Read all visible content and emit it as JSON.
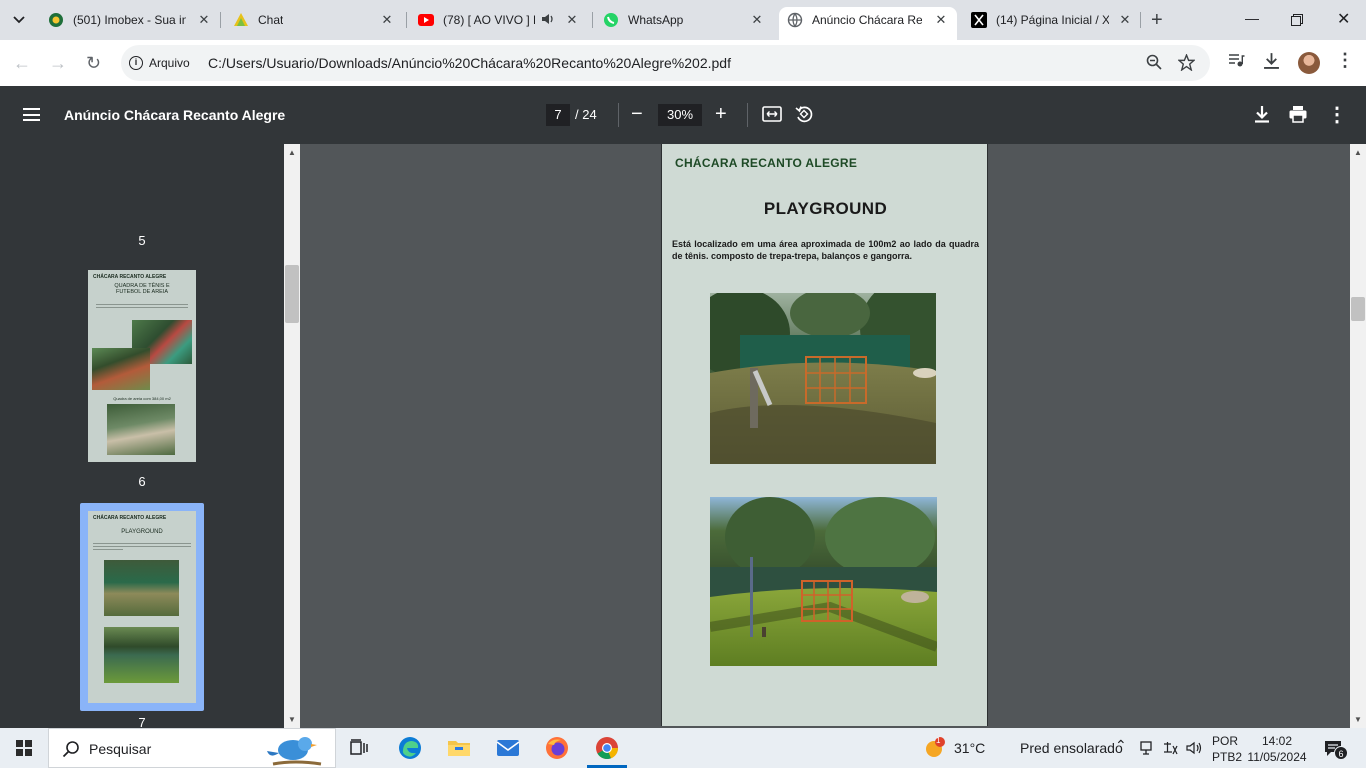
{
  "browser": {
    "tabs": [
      {
        "title": "(501) Imobex - Sua in",
        "icon": "imobex-favicon"
      },
      {
        "title": "Chat",
        "icon": "chat-favicon"
      },
      {
        "title": "(78) [ AO VIVO ] L",
        "icon": "youtube-favicon"
      },
      {
        "title": "WhatsApp",
        "icon": "whatsapp-favicon"
      },
      {
        "title": "Anúncio Chácara Rec",
        "icon": "globe-favicon"
      },
      {
        "title": "(14) Página Inicial / X",
        "icon": "x-favicon"
      }
    ],
    "active_tab_index": 4,
    "address": {
      "security_label": "Arquivo",
      "url": "C:/Users/Usuario/Downloads/Anúncio%20Chácara%20Recanto%20Alegre%202.pdf"
    }
  },
  "pdf": {
    "title": "Anúncio Chácara Recanto Alegre",
    "current_page": "7",
    "total_pages": "/ 24",
    "zoom": "30%"
  },
  "sidebar": {
    "thumbnails": [
      {
        "number": "5"
      },
      {
        "number": "6",
        "brand": "CHÁCARA RECANTO ALEGRE",
        "title": "QUADRA DE TÊNIS E FUTEBOL DE AREIA",
        "caption": "Quadra de areia com 384,00 m2"
      },
      {
        "number": "7",
        "brand": "CHÁCARA RECANTO ALEGRE",
        "title": "PLAYGROUND",
        "selected": true
      }
    ]
  },
  "page": {
    "brand": "CHÁCARA RECANTO ALEGRE",
    "title": "PLAYGROUND",
    "text": "Está localizado em uma área aproximada de 100m2 ao lado da quadra de tênis. composto de trepa-trepa, balanços e gangorra.",
    "background_color": "#cfdad4",
    "brand_color": "#1e4a26"
  },
  "taskbar": {
    "search_placeholder": "Pesquisar",
    "weather_temp": "31°C",
    "weather_desc": "Pred ensolarado",
    "weather_badge": "1",
    "lang_line1": "POR",
    "lang_line2": "PTB2",
    "time": "14:02",
    "date": "11/05/2024",
    "notification_count": "6"
  }
}
